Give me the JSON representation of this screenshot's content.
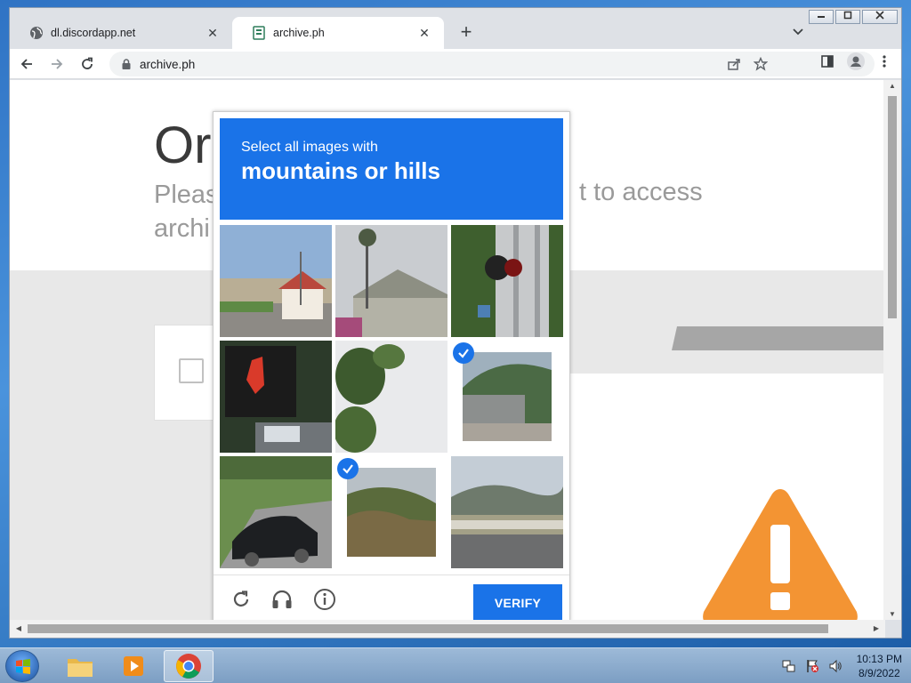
{
  "window": {
    "minimize": "▭",
    "maximize": "▣",
    "close": "✕"
  },
  "tabs": [
    {
      "title": "dl.discordapp.net",
      "active": false
    },
    {
      "title": "archive.ph",
      "active": true
    }
  ],
  "toolbar": {
    "url": "archive.ph"
  },
  "background_page": {
    "heading": "Or",
    "subtitle_left": "Pleas\narchi",
    "subtitle_right": "t to access"
  },
  "captcha": {
    "instruction": "Select all images with",
    "target": "mountains or hills",
    "verify_label": "VERIFY",
    "tiles": [
      {
        "selected": false,
        "scene": "street-houses"
      },
      {
        "selected": false,
        "scene": "house-palm"
      },
      {
        "selected": false,
        "scene": "rail-signal"
      },
      {
        "selected": false,
        "scene": "traffic-light"
      },
      {
        "selected": false,
        "scene": "tree-leaves"
      },
      {
        "selected": true,
        "scene": "hill-buildings"
      },
      {
        "selected": false,
        "scene": "black-car"
      },
      {
        "selected": true,
        "scene": "hill-trees"
      },
      {
        "selected": false,
        "scene": "road-mountains"
      }
    ]
  },
  "taskbar": {
    "time": "10:13 PM",
    "date": "8/9/2022"
  },
  "colors": {
    "captcha_blue": "#1a73e8",
    "warning_orange": "#f39433"
  }
}
